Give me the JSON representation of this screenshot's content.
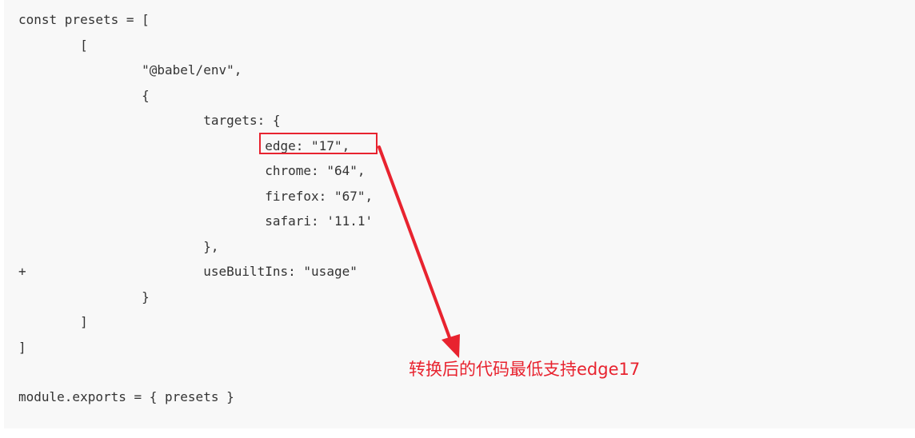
{
  "code": {
    "lines": [
      "const presets = [",
      "        [",
      "                \"@babel/env\",",
      "                {",
      "                        targets: {",
      "                                edge: \"17\",",
      "                                chrome: \"64\",",
      "                                firefox: \"67\",",
      "                                safari: '11.1'",
      "                        },",
      "                        useBuiltIns: \"usage\"",
      "                }",
      "        ]",
      "]",
      "",
      "module.exports = { presets }"
    ],
    "diff_marker": "+"
  },
  "annotation": {
    "text": "转换后的代码最低支持edge17",
    "color": "#e8232f"
  }
}
